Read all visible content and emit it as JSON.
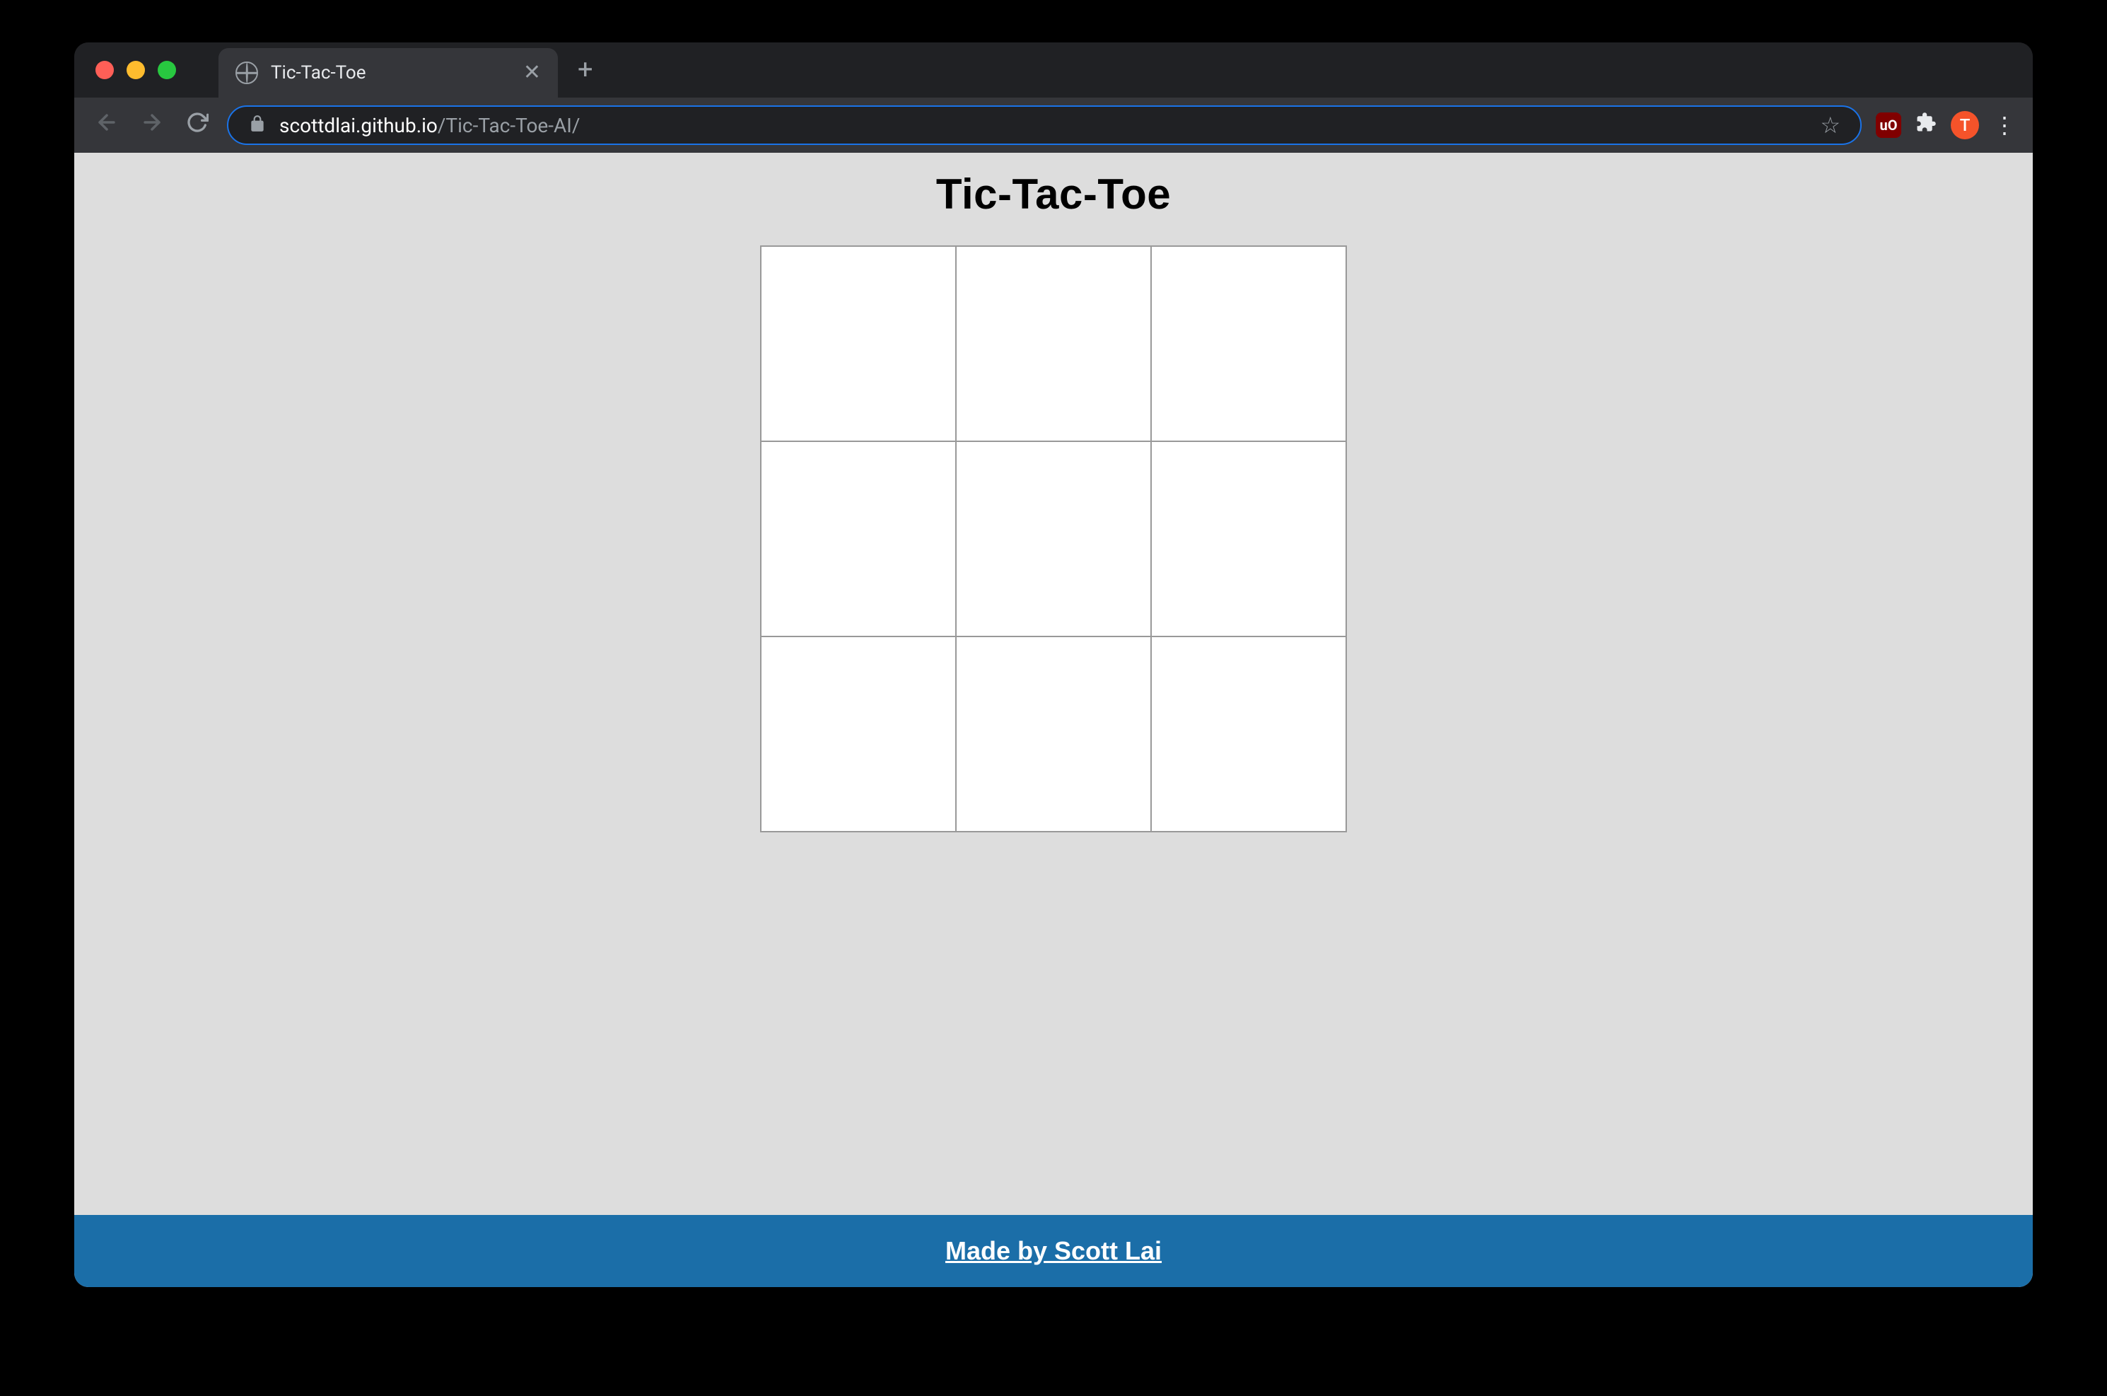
{
  "browser": {
    "tab": {
      "title": "Tic-Tac-Toe"
    },
    "url": {
      "domain": "scottdlai.github.io",
      "path": "/Tic-Tac-Toe-AI/"
    },
    "avatar_initial": "T",
    "ublock_label": "uO"
  },
  "page": {
    "title": "Tic-Tac-Toe",
    "board": {
      "cells": [
        "",
        "",
        "",
        "",
        "",
        "",
        "",
        "",
        ""
      ]
    },
    "footer": {
      "link_text": "Made by Scott Lai"
    }
  }
}
